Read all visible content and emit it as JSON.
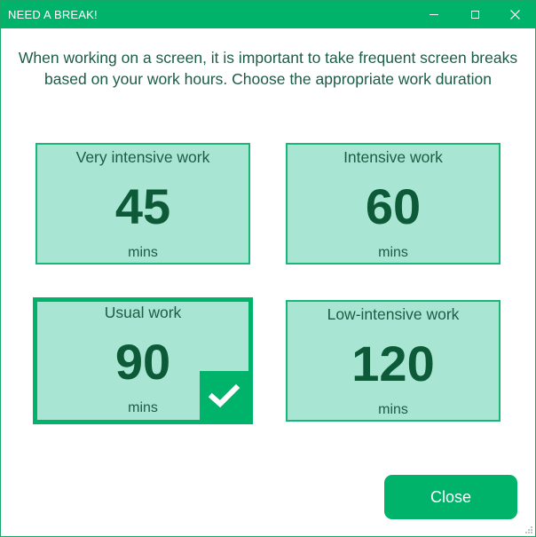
{
  "window": {
    "title": "NEED A BREAK!",
    "controls": {
      "minimize": "minimize-icon",
      "maximize": "maximize-icon",
      "close": "close-icon"
    }
  },
  "instructions": "When working on a screen, it is important to take frequent screen breaks based on your work hours. Choose the appropriate work duration",
  "options": [
    {
      "label": "Very intensive work",
      "value": "45",
      "unit": "mins",
      "selected": false
    },
    {
      "label": "Intensive work",
      "value": "60",
      "unit": "mins",
      "selected": false
    },
    {
      "label": "Usual work",
      "value": "90",
      "unit": "mins",
      "selected": true
    },
    {
      "label": "Low-intensive work",
      "value": "120",
      "unit": "mins",
      "selected": false
    }
  ],
  "footer": {
    "close_label": "Close"
  },
  "colors": {
    "accent": "#00b36b",
    "card_fill": "#a8e6d3",
    "text_dark": "#1d5c45",
    "value_text": "#0d5a38"
  }
}
